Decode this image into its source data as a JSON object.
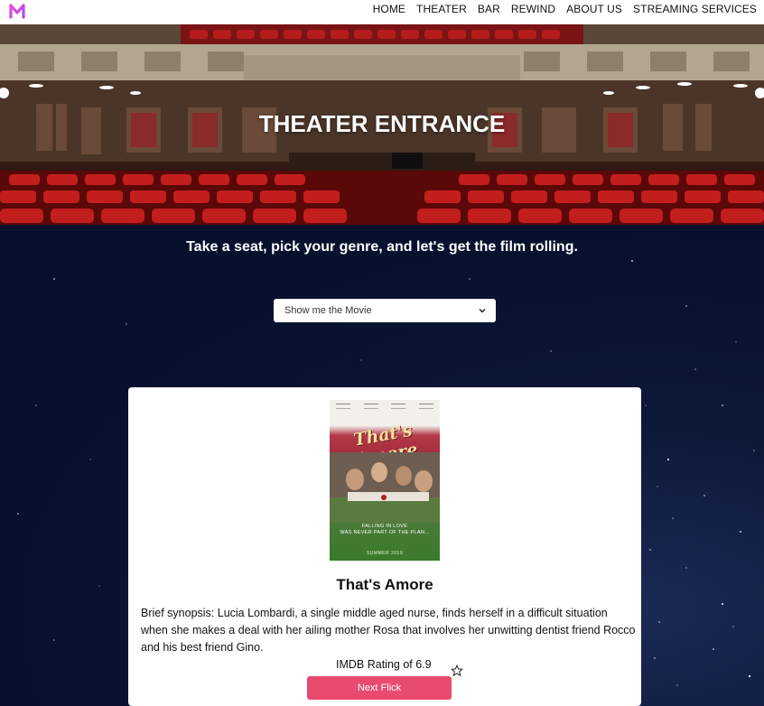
{
  "nav": {
    "logo_letter": "M",
    "links": [
      "HOME",
      "THEATER",
      "BAR",
      "REWIND",
      "ABOUT US",
      "STREAMING SERVICES"
    ]
  },
  "hero": {
    "title": "THEATER ENTRANCE"
  },
  "main": {
    "tagline": "Take a seat, pick your genre, and let's get the film rolling.",
    "genre_select": {
      "value": "Show me the Movie"
    }
  },
  "movie": {
    "title": "That's Amore",
    "poster": {
      "script_title": "That's Amore",
      "tagline": "FALLING IN LOVE\nWAS NEVER PART OF THE PLAN...",
      "date": "SUMMER 2019"
    },
    "synopsis": "Brief synopsis: Lucia Lombardi, a single middle aged nurse, finds herself in a difficult situation when she makes a deal with her ailing mother Rosa that involves her unwitting dentist friend Rocco and his best friend Gino.",
    "rating": "IMDB Rating of 6.9",
    "next_button": "Next Flick"
  },
  "colors": {
    "logo_gradient": [
      "#f24bd1",
      "#a44bf2"
    ],
    "button": "#e94b6e",
    "page_bg": "#07112e"
  }
}
